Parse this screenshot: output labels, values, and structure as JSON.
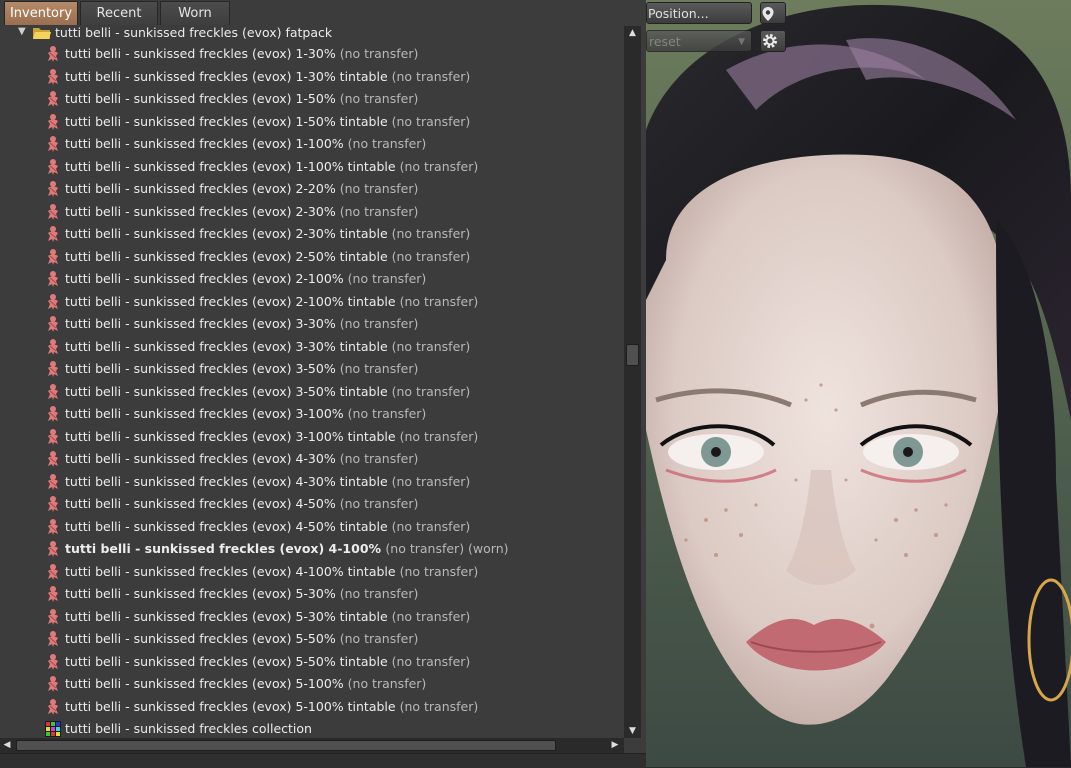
{
  "tabs": [
    {
      "label": "Inventory",
      "active": true
    },
    {
      "label": "Recent",
      "active": false
    },
    {
      "label": "Worn",
      "active": false
    }
  ],
  "folder": {
    "label": "tutti belli - sunkissed freckles (evox) fatpack",
    "expanded": true
  },
  "items": [
    {
      "name": "tutti belli - sunkissed freckles (evox) 1-30%",
      "suffix": "(no transfer)",
      "icon": "bodypart-icon"
    },
    {
      "name": "tutti belli - sunkissed freckles (evox) 1-30% tintable",
      "suffix": "(no transfer)",
      "icon": "bodypart-icon"
    },
    {
      "name": "tutti belli - sunkissed freckles (evox) 1-50%",
      "suffix": "(no transfer)",
      "icon": "bodypart-icon"
    },
    {
      "name": "tutti belli - sunkissed freckles (evox) 1-50% tintable",
      "suffix": "(no transfer)",
      "icon": "bodypart-icon"
    },
    {
      "name": "tutti belli - sunkissed freckles (evox) 1-100%",
      "suffix": "(no transfer)",
      "icon": "bodypart-icon"
    },
    {
      "name": "tutti belli - sunkissed freckles (evox) 1-100% tintable",
      "suffix": "(no transfer)",
      "icon": "bodypart-icon"
    },
    {
      "name": "tutti belli - sunkissed freckles (evox) 2-20%",
      "suffix": "(no transfer)",
      "icon": "bodypart-icon"
    },
    {
      "name": "tutti belli - sunkissed freckles (evox) 2-30%",
      "suffix": "(no transfer)",
      "icon": "bodypart-icon"
    },
    {
      "name": "tutti belli - sunkissed freckles (evox) 2-30% tintable",
      "suffix": "(no transfer)",
      "icon": "bodypart-icon"
    },
    {
      "name": "tutti belli - sunkissed freckles (evox) 2-50% tintable",
      "suffix": "(no transfer)",
      "icon": "bodypart-icon"
    },
    {
      "name": "tutti belli - sunkissed freckles (evox) 2-100%",
      "suffix": "(no transfer)",
      "icon": "bodypart-icon"
    },
    {
      "name": "tutti belli - sunkissed freckles (evox) 2-100% tintable",
      "suffix": "(no transfer)",
      "icon": "bodypart-icon"
    },
    {
      "name": "tutti belli - sunkissed freckles (evox) 3-30%",
      "suffix": "(no transfer)",
      "icon": "bodypart-icon"
    },
    {
      "name": "tutti belli - sunkissed freckles (evox) 3-30% tintable",
      "suffix": "(no transfer)",
      "icon": "bodypart-icon"
    },
    {
      "name": "tutti belli - sunkissed freckles (evox) 3-50%",
      "suffix": "(no transfer)",
      "icon": "bodypart-icon"
    },
    {
      "name": "tutti belli - sunkissed freckles (evox) 3-50% tintable",
      "suffix": "(no transfer)",
      "icon": "bodypart-icon"
    },
    {
      "name": "tutti belli - sunkissed freckles (evox) 3-100%",
      "suffix": "(no transfer)",
      "icon": "bodypart-icon"
    },
    {
      "name": "tutti belli - sunkissed freckles (evox) 3-100% tintable",
      "suffix": "(no transfer)",
      "icon": "bodypart-icon"
    },
    {
      "name": "tutti belli - sunkissed freckles (evox) 4-30%",
      "suffix": "(no transfer)",
      "icon": "bodypart-icon"
    },
    {
      "name": "tutti belli - sunkissed freckles (evox) 4-30% tintable",
      "suffix": "(no transfer)",
      "icon": "bodypart-icon"
    },
    {
      "name": "tutti belli - sunkissed freckles (evox) 4-50%",
      "suffix": "(no transfer)",
      "icon": "bodypart-icon"
    },
    {
      "name": "tutti belli - sunkissed freckles (evox) 4-50% tintable",
      "suffix": "(no transfer)",
      "icon": "bodypart-icon"
    },
    {
      "name": "tutti belli - sunkissed freckles (evox) 4-100%",
      "suffix": "(no transfer) (worn)",
      "icon": "bodypart-icon",
      "worn": true
    },
    {
      "name": "tutti belli - sunkissed freckles (evox) 4-100% tintable",
      "suffix": "(no transfer)",
      "icon": "bodypart-icon"
    },
    {
      "name": "tutti belli - sunkissed freckles (evox) 5-30%",
      "suffix": "(no transfer)",
      "icon": "bodypart-icon"
    },
    {
      "name": "tutti belli - sunkissed freckles (evox) 5-30% tintable",
      "suffix": "(no transfer)",
      "icon": "bodypart-icon"
    },
    {
      "name": "tutti belli - sunkissed freckles (evox) 5-50%",
      "suffix": "(no transfer)",
      "icon": "bodypart-icon"
    },
    {
      "name": "tutti belli - sunkissed freckles (evox) 5-50% tintable",
      "suffix": "(no transfer)",
      "icon": "bodypart-icon"
    },
    {
      "name": "tutti belli - sunkissed freckles (evox) 5-100%",
      "suffix": "(no transfer)",
      "icon": "bodypart-icon"
    },
    {
      "name": "tutti belli - sunkissed freckles (evox) 5-100% tintable",
      "suffix": "(no transfer)",
      "icon": "bodypart-icon"
    },
    {
      "name": "tutti belli - sunkissed freckles collection",
      "suffix": "",
      "icon": "texture-icon"
    }
  ],
  "viewport": {
    "position_button": "Position...",
    "preset_dropdown": "reset"
  },
  "colors": {
    "panel_bg": "#3c3c3c",
    "active_tab": "#a87c5c",
    "bodypart_icon": "#e07a7a"
  }
}
